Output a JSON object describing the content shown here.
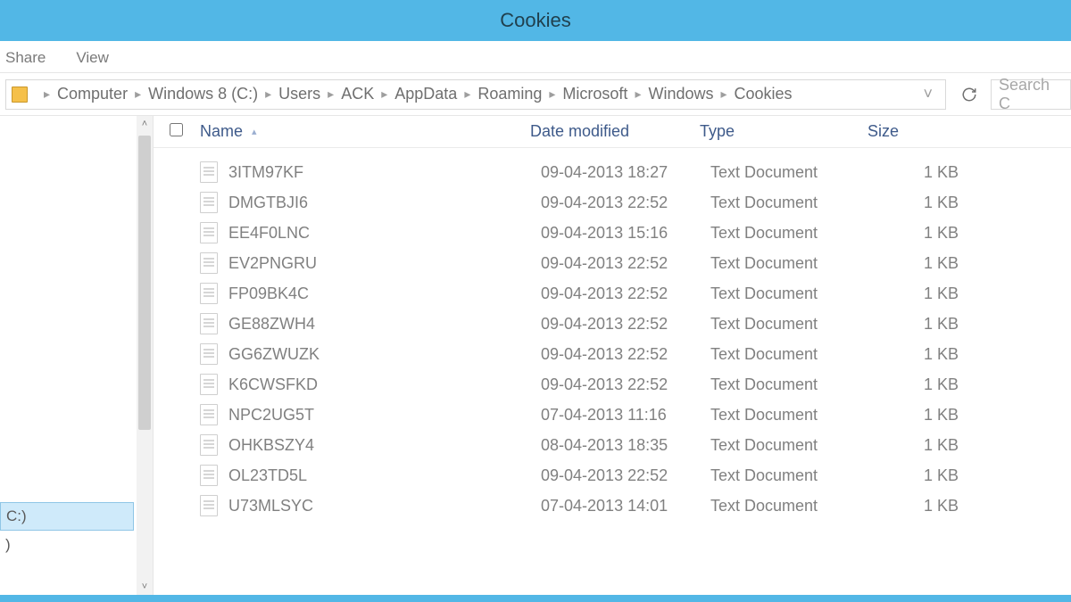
{
  "window": {
    "title": "Cookies"
  },
  "ribbon": {
    "tabs": [
      "Share",
      "View"
    ]
  },
  "address": {
    "crumbs": [
      "Computer",
      "Windows 8 (C:)",
      "Users",
      "ACK",
      "AppData",
      "Roaming",
      "Microsoft",
      "Windows",
      "Cookies"
    ],
    "search_placeholder": "Search C"
  },
  "nav": {
    "items": [
      "C:)",
      ")"
    ],
    "selected_index": 0
  },
  "columns": {
    "check": "",
    "name": "Name",
    "date": "Date modified",
    "type": "Type",
    "size": "Size"
  },
  "files": [
    {
      "name": "3ITM97KF",
      "date": "09-04-2013 18:27",
      "type": "Text Document",
      "size": "1 KB"
    },
    {
      "name": "DMGTBJI6",
      "date": "09-04-2013 22:52",
      "type": "Text Document",
      "size": "1 KB"
    },
    {
      "name": "EE4F0LNC",
      "date": "09-04-2013 15:16",
      "type": "Text Document",
      "size": "1 KB"
    },
    {
      "name": "EV2PNGRU",
      "date": "09-04-2013 22:52",
      "type": "Text Document",
      "size": "1 KB"
    },
    {
      "name": "FP09BK4C",
      "date": "09-04-2013 22:52",
      "type": "Text Document",
      "size": "1 KB"
    },
    {
      "name": "GE88ZWH4",
      "date": "09-04-2013 22:52",
      "type": "Text Document",
      "size": "1 KB"
    },
    {
      "name": "GG6ZWUZK",
      "date": "09-04-2013 22:52",
      "type": "Text Document",
      "size": "1 KB"
    },
    {
      "name": "K6CWSFKD",
      "date": "09-04-2013 22:52",
      "type": "Text Document",
      "size": "1 KB"
    },
    {
      "name": "NPC2UG5T",
      "date": "07-04-2013 11:16",
      "type": "Text Document",
      "size": "1 KB"
    },
    {
      "name": "OHKBSZY4",
      "date": "08-04-2013 18:35",
      "type": "Text Document",
      "size": "1 KB"
    },
    {
      "name": "OL23TD5L",
      "date": "09-04-2013 22:52",
      "type": "Text Document",
      "size": "1 KB"
    },
    {
      "name": "U73MLSYC",
      "date": "07-04-2013 14:01",
      "type": "Text Document",
      "size": "1 KB"
    }
  ]
}
